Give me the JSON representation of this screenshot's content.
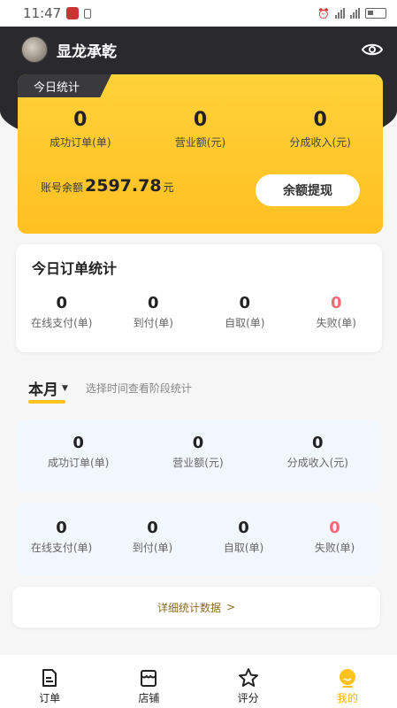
{
  "status_bar": {
    "time": "11:47"
  },
  "user": {
    "name": "显龙承乾"
  },
  "today": {
    "tab_label": "今日统计",
    "stats": [
      {
        "value": "0",
        "label": "成功订单(单)"
      },
      {
        "value": "0",
        "label": "营业额(元)"
      },
      {
        "value": "0",
        "label": "分成收入(元)"
      }
    ],
    "balance_label": "账号余额",
    "balance_value": "2597.78",
    "balance_unit": "元",
    "withdraw_label": "余额提现"
  },
  "today_orders": {
    "title": "今日订单统计",
    "stats": [
      {
        "value": "0",
        "label": "在线支付(单)"
      },
      {
        "value": "0",
        "label": "到付(单)"
      },
      {
        "value": "0",
        "label": "自取(单)"
      },
      {
        "value": "0",
        "label": "失败(单)"
      }
    ]
  },
  "month": {
    "selector_label": "本月",
    "hint": "选择时间查看阶段统计",
    "stats": [
      {
        "value": "0",
        "label": "成功订单(单)"
      },
      {
        "value": "0",
        "label": "营业额(元)"
      },
      {
        "value": "0",
        "label": "分成收入(元)"
      }
    ],
    "order_stats": [
      {
        "value": "0",
        "label": "在线支付(单)"
      },
      {
        "value": "0",
        "label": "到付(单)"
      },
      {
        "value": "0",
        "label": "自取(单)"
      },
      {
        "value": "0",
        "label": "失败(单)"
      }
    ]
  },
  "detail_link": "详细统计数据",
  "tabbar": [
    {
      "label": "订单",
      "icon": "order-icon"
    },
    {
      "label": "店铺",
      "icon": "shop-icon"
    },
    {
      "label": "评分",
      "icon": "star-icon"
    },
    {
      "label": "我的",
      "icon": "profile-icon",
      "active": true
    }
  ],
  "colors": {
    "accent": "#ffc21e",
    "fail": "#ef6b78",
    "dark": "#2a2a2e"
  }
}
